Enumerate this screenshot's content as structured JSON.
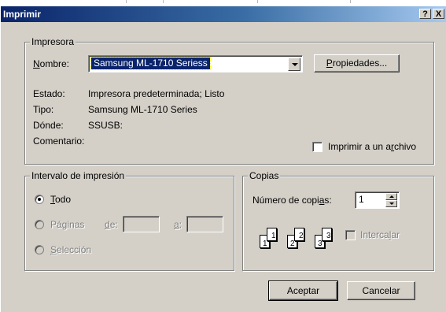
{
  "window": {
    "title": "Imprimir",
    "help_label": "?",
    "close_label": "X"
  },
  "printer": {
    "group_label": "Impresora",
    "name_label": "Nombre:",
    "name_key": "N",
    "name_rest": "ombre:",
    "selected_printer": "Samsung ML-1710 Seriess",
    "properties_key": "P",
    "properties_rest": "ropiedades...",
    "status_label": "Estado:",
    "status_value": "Impresora predeterminada; Listo",
    "type_label": "Tipo:",
    "type_value": "Samsung ML-1710 Series",
    "where_label": "Dónde:",
    "where_value": "SSUSB:",
    "comment_label": "Comentario:",
    "print_to_file_pre": "Imprimir a un a",
    "print_to_file_key": "r",
    "print_to_file_post": "chivo"
  },
  "range": {
    "group_label": "Intervalo de impresión",
    "all_key": "T",
    "all_rest": "odo",
    "pages_label": "Páginas",
    "from_key": "d",
    "from_rest": "e:",
    "to_key": "a",
    "to_rest": ":",
    "selection_key": "S",
    "selection_rest": "elección"
  },
  "copies": {
    "group_label": "Copias",
    "count_pre": "Número de copi",
    "count_key": "a",
    "count_post": "s:",
    "count_value": "1",
    "collate_pre": "Interca",
    "collate_key": "l",
    "collate_post": "ar",
    "sheet_numbers": [
      "1",
      "1",
      "2",
      "2",
      "3",
      "3"
    ]
  },
  "footer": {
    "ok_label": "Aceptar",
    "cancel_label": "Cancelar"
  },
  "colors": {
    "titlebar_start": "#0a246a",
    "titlebar_end": "#a6caf0",
    "face": "#d4d0c8",
    "selection": "#0a246a"
  }
}
